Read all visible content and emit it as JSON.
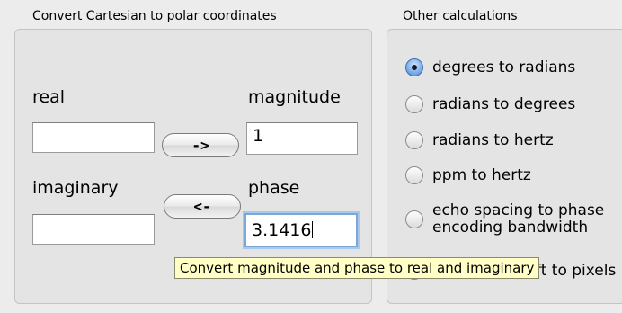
{
  "left_group": {
    "title": "Convert Cartesian to polar coordinates",
    "real_label": "real",
    "imaginary_label": "imaginary",
    "magnitude_label": "magnitude",
    "phase_label": "phase",
    "real_value": "",
    "imaginary_value": "",
    "magnitude_value": "1",
    "phase_value": "3.1416",
    "to_polar_button": "->",
    "to_cartesian_button": "<-"
  },
  "right_group": {
    "title": "Other calculations",
    "options": [
      {
        "label": "degrees to radians",
        "selected": true
      },
      {
        "label": "radians to degrees",
        "selected": false
      },
      {
        "label": "radians to hertz",
        "selected": false
      },
      {
        "label": "ppm to hertz",
        "selected": false
      },
      {
        "label_line1": "echo spacing to phase",
        "label_line2": "encoding bandwidth",
        "selected": false
      },
      {
        "label": "frequency shift to pixels",
        "selected": false
      }
    ]
  },
  "tooltip": {
    "text": "Convert magnitude and phase to real and imaginary",
    "color": "#ffffc6"
  }
}
